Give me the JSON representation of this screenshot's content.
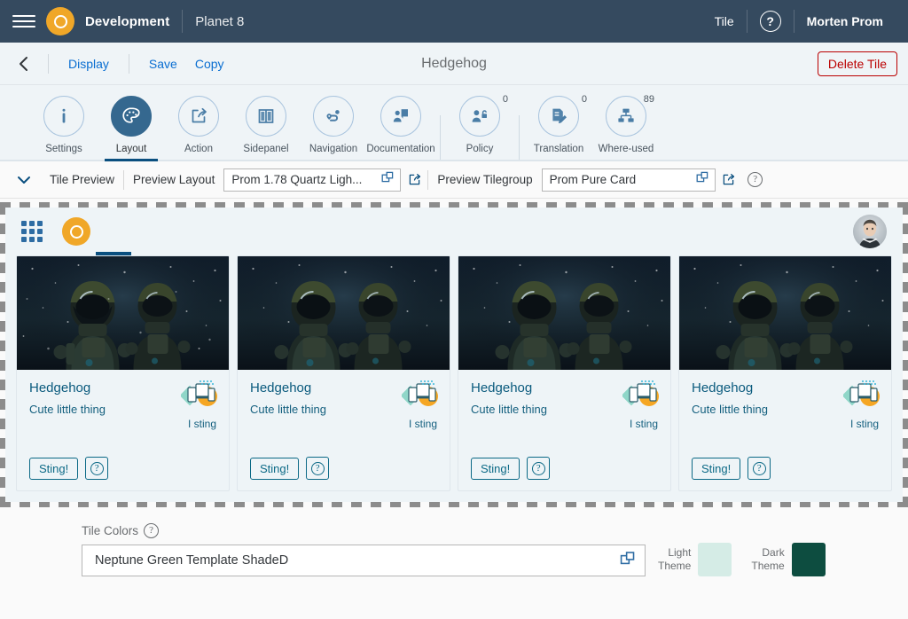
{
  "shellbar": {
    "menu_icon": "hamburger-menu-icon",
    "logo_icon": "neptune-logo-icon",
    "title": "Development",
    "subtitle": "Planet 8",
    "right_items": [
      {
        "label": "Tile",
        "name": "shell-item-tile"
      }
    ],
    "help_icon": "help-icon",
    "user": "Morten Prom"
  },
  "pageheader": {
    "back_icon": "back-arrow-icon",
    "links": [
      {
        "label": "Display",
        "name": "display-link"
      },
      {
        "label": "Save",
        "name": "save-link"
      },
      {
        "label": "Copy",
        "name": "copy-link"
      }
    ],
    "title": "Hedgehog",
    "delete_label": "Delete Tile"
  },
  "icontabs": [
    {
      "label": "Settings",
      "icon": "info-icon",
      "selected": false,
      "badge": ""
    },
    {
      "label": "Layout",
      "icon": "palette-icon",
      "selected": true,
      "badge": ""
    },
    {
      "label": "Action",
      "icon": "share-action-icon",
      "selected": false,
      "badge": ""
    },
    {
      "label": "Sidepanel",
      "icon": "sidepanel-icon",
      "selected": false,
      "badge": ""
    },
    {
      "label": "Navigation",
      "icon": "navigation-route-icon",
      "selected": false,
      "badge": ""
    },
    {
      "label": "Documentation",
      "icon": "documentation-icon",
      "selected": false,
      "badge": ""
    },
    {
      "label": "Policy",
      "icon": "policy-lock-icon",
      "selected": false,
      "badge": "0"
    },
    {
      "label": "Translation",
      "icon": "translation-edit-icon",
      "selected": false,
      "badge": "0"
    },
    {
      "label": "Where-used",
      "icon": "where-used-tree-icon",
      "selected": false,
      "badge": "89"
    }
  ],
  "previewbar": {
    "collapse_icon": "chevron-down-icon",
    "section_label": "Tile Preview",
    "layout_label": "Preview Layout",
    "layout_value": "Prom 1.78 Quartz Ligh...",
    "layout_valuehelp_icon": "value-help-icon",
    "layout_open_icon": "open-external-icon",
    "tilegroup_label": "Preview Tilegroup",
    "tilegroup_value": "Prom Pure Card",
    "tilegroup_valuehelp_icon": "value-help-icon",
    "tilegroup_open_icon": "open-external-icon",
    "help_icon": "help-icon"
  },
  "preview": {
    "grid_icon": "app-grid-icon",
    "logo_icon": "neptune-logo-icon",
    "avatar": "user-avatar",
    "tiles": [
      {
        "title": "Hedgehog",
        "subtitle": "Cute little thing",
        "note": "I sting",
        "button": "Sting!",
        "help_icon": "help-icon",
        "device_icon": "multi-device-icon"
      },
      {
        "title": "Hedgehog",
        "subtitle": "Cute little thing",
        "note": "I sting",
        "button": "Sting!",
        "help_icon": "help-icon",
        "device_icon": "multi-device-icon"
      },
      {
        "title": "Hedgehog",
        "subtitle": "Cute little thing",
        "note": "I sting",
        "button": "Sting!",
        "help_icon": "help-icon",
        "device_icon": "multi-device-icon"
      },
      {
        "title": "Hedgehog",
        "subtitle": "Cute little thing",
        "note": "I sting",
        "button": "Sting!",
        "help_icon": "help-icon",
        "device_icon": "multi-device-icon"
      }
    ]
  },
  "tilecolors": {
    "label": "Tile Colors",
    "help_icon": "help-icon",
    "value": "Neptune Green Template ShadeD",
    "valuehelp_icon": "value-help-icon",
    "light_label_line1": "Light",
    "light_label_line2": "Theme",
    "light_color": "#d5ece6",
    "dark_label_line1": "Dark",
    "dark_label_line2": "Theme",
    "dark_color": "#0d4d40"
  },
  "colors": {
    "shellbar_bg": "#354a5f",
    "brand_orange": "#f0a728",
    "accent_blue": "#0a6ed1",
    "selected_tab": "#35688f",
    "delete_red": "#bb0000",
    "tile_bg": "#eef4f7",
    "tile_text": "#0a5a7d"
  }
}
